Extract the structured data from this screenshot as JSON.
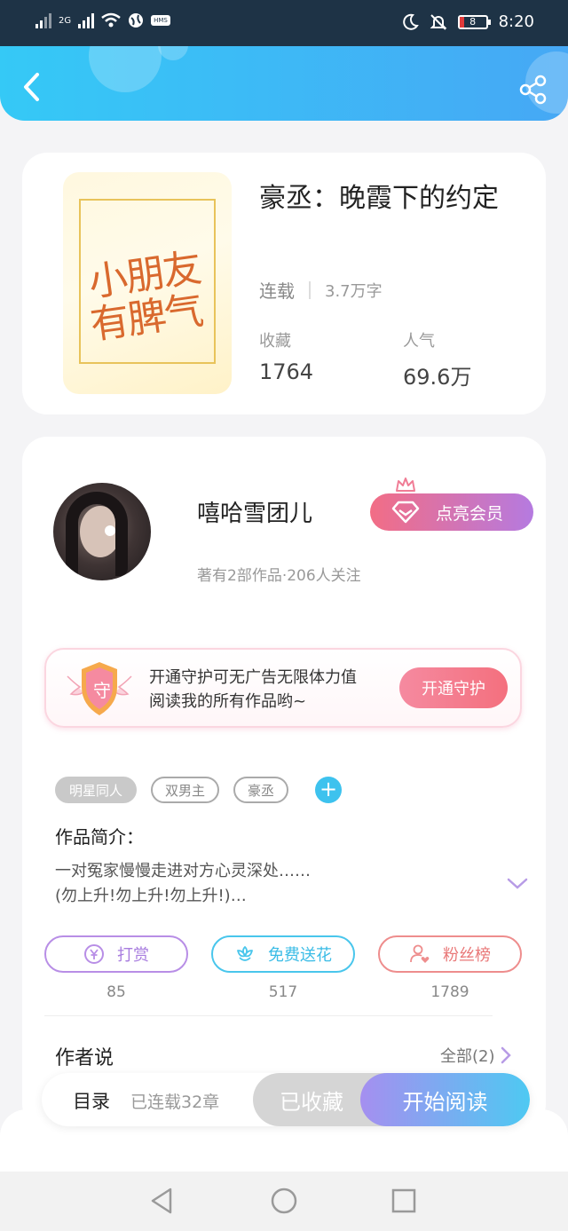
{
  "status_bar": {
    "network": "2G",
    "hms": "HMS",
    "battery": "8",
    "time": "8:20"
  },
  "header": {
    "back_icon": "chevron-left-icon",
    "share_icon": "share-icon"
  },
  "book": {
    "cover_text_line1": "小朋友",
    "cover_text_line2": "有脾气",
    "title": "豪丞：晚霞下的约定",
    "status": "连载",
    "word_count": "3.7万字",
    "favorites_label": "收藏",
    "favorites_value": "1764",
    "popularity_label": "人气",
    "popularity_value": "69.6万"
  },
  "author": {
    "name": "嘻哈雪团儿",
    "stats": "著有2部作品·206人关注",
    "vip_button": "点亮会员"
  },
  "guard": {
    "badge": "守",
    "text_line1": "开通守护可无广告无限体力值",
    "text_line2": "阅读我的所有作品哟~",
    "button": "开通守护"
  },
  "tags": [
    "明星同人",
    "双男主",
    "豪丞"
  ],
  "intro": {
    "title": "作品简介：",
    "line1": "一对冤家慢慢走进对方心灵深处……",
    "line2": "(勿上升!勿上升!勿上升!)…"
  },
  "actions": {
    "tip_label": "打赏",
    "tip_count": "85",
    "flower_label": "免费送花",
    "flower_count": "517",
    "fans_label": "粉丝榜",
    "fans_count": "1789"
  },
  "author_says": {
    "title": "作者说",
    "all_link": "全部(2)"
  },
  "bottom_bar": {
    "toc": "目录",
    "chapters": "已连载32章",
    "collected": "已收藏",
    "read": "开始阅读"
  },
  "colors": {
    "header_gradient_start": "#35c9f6",
    "header_gradient_end": "#46a8f5",
    "vip_pink": "#f26d85",
    "vip_purple": "#b57ae0",
    "tip_purple": "#b88ee6",
    "flower_cyan": "#49c6ec",
    "fans_red": "#ee8d8d"
  }
}
